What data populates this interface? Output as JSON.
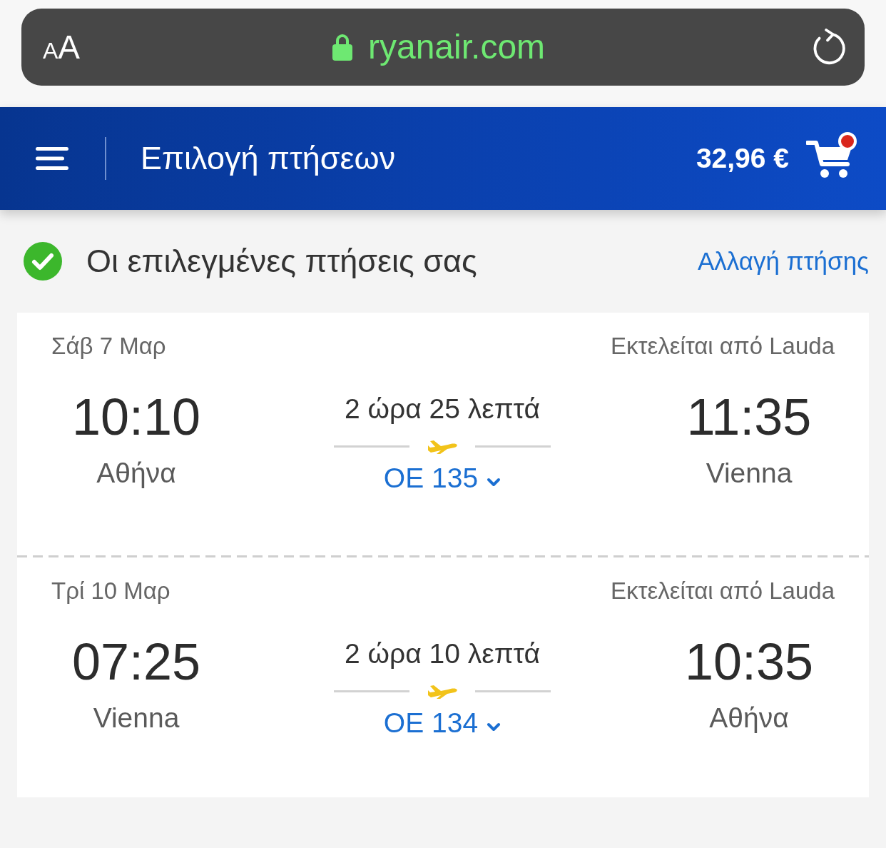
{
  "browser_bar": {
    "text_size_button": {
      "small": "A",
      "large": "A"
    },
    "secure": true,
    "url": "ryanair.com"
  },
  "header": {
    "title": "Επιλογή πτήσεων",
    "total": "32,96 €",
    "cart_dot": true
  },
  "selected_flights": {
    "title": "Οι επιλεγμένες πτήσεις σας",
    "change_link": "Αλλαγή πτήσης",
    "flights": [
      {
        "date": "Σάβ 7 Μαρ",
        "operator": "Εκτελείται από Lauda",
        "departure_time": "10:10",
        "departure_city": "Αθήνα",
        "duration": "2 ώρα 25 λεπτά",
        "flight_number": "OE 135",
        "expanded": false,
        "arrival_time": "11:35",
        "arrival_city": "Vienna"
      },
      {
        "date": "Τρί 10 Μαρ",
        "operator": "Εκτελείται από Lauda",
        "departure_time": "07:25",
        "departure_city": "Vienna",
        "duration": "2 ώρα 10 λεπτά",
        "flight_number": "OE 134",
        "expanded": false,
        "arrival_time": "10:35",
        "arrival_city": "Αθήνα"
      }
    ]
  }
}
